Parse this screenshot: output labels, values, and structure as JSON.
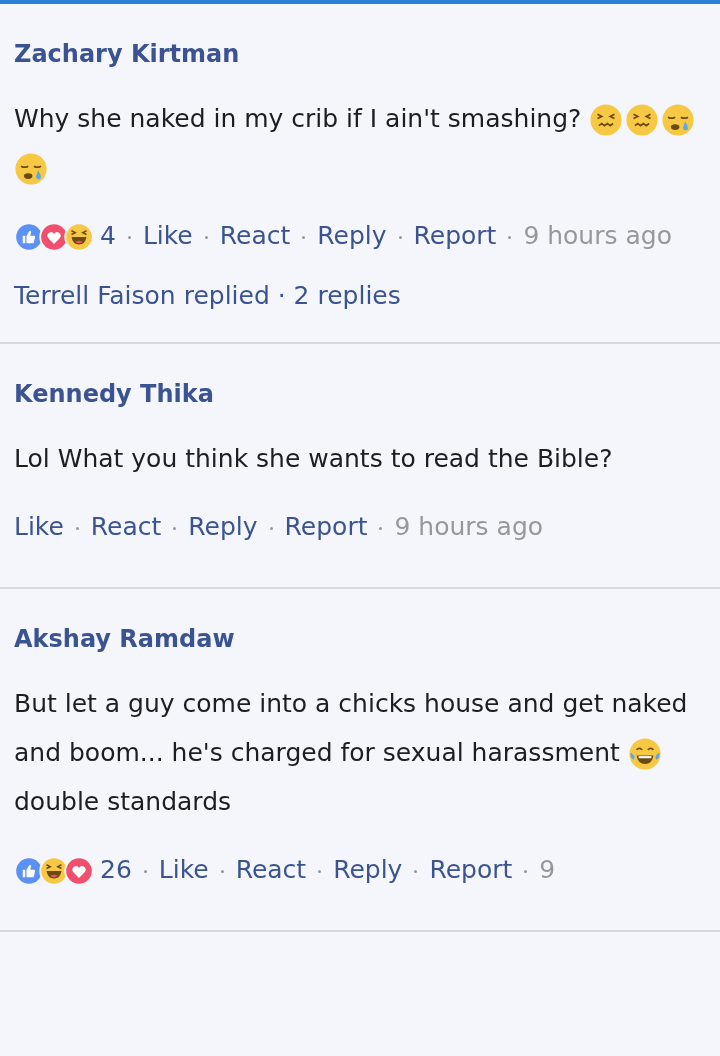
{
  "comments": [
    {
      "author": "Zachary Kirtman",
      "body": [
        {
          "kind": "text",
          "text": "Why she naked in my crib if I ain't smashing? "
        },
        {
          "kind": "grimace"
        },
        {
          "kind": "grimace"
        },
        {
          "kind": "sleepy"
        },
        {
          "kind": "sleepy"
        }
      ],
      "reactions": [
        {
          "kind": "like"
        },
        {
          "kind": "love"
        },
        {
          "kind": "haha"
        }
      ],
      "count": "4",
      "actions": [
        "Like",
        "React",
        "Reply",
        "Report"
      ],
      "time": "9 hours ago",
      "replies": "Terrell Faison replied · 2 replies"
    },
    {
      "author": "Kennedy Thika",
      "body": [
        {
          "kind": "text",
          "text": "Lol What you think she wants to read the Bible?"
        }
      ],
      "actions": [
        "Like",
        "React",
        "Reply",
        "Report"
      ],
      "time": "9 hours ago"
    },
    {
      "author": "Akshay Ramdaw",
      "body": [
        {
          "kind": "text",
          "text": "But let a guy come into a chicks house and get naked and boom... he's charged for sexual harassment "
        },
        {
          "kind": "laugh"
        },
        {
          "kind": "text",
          "text": " double standards"
        }
      ],
      "reactions": [
        {
          "kind": "like"
        },
        {
          "kind": "haha"
        },
        {
          "kind": "love"
        }
      ],
      "count": "26",
      "actions": [
        "Like",
        "React",
        "Reply",
        "Report"
      ],
      "time": "9"
    }
  ]
}
